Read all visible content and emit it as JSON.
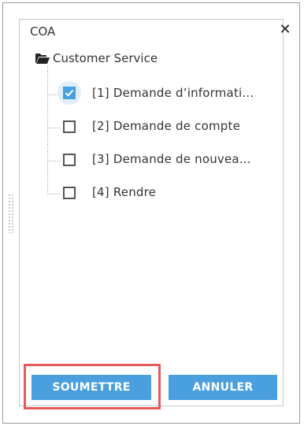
{
  "dialog": {
    "title": "COA",
    "close_icon": "close-icon",
    "tree": {
      "root": {
        "label": "Customer Service",
        "icon": "folder-open-icon"
      },
      "items": [
        {
          "label": "[1] Demande d’informati...",
          "checked": true
        },
        {
          "label": "[2] Demande de compte",
          "checked": false
        },
        {
          "label": "[3] Demande de nouvea...",
          "checked": false
        },
        {
          "label": "[4] Rendre",
          "checked": false
        }
      ]
    },
    "buttons": {
      "submit": "SOUMETTRE",
      "cancel": "ANNULER"
    }
  },
  "colors": {
    "accent": "#4a9fde",
    "highlight": "#e65a5a",
    "halo": "#dfeef8"
  }
}
